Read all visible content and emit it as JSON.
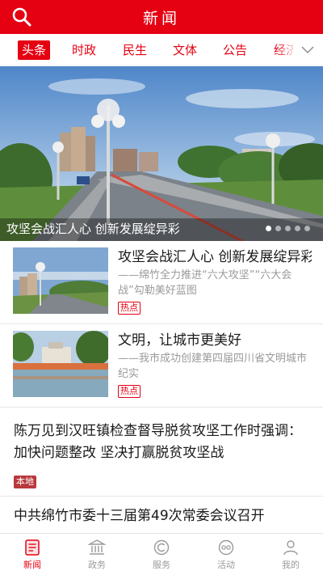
{
  "header": {
    "title": "新闻",
    "search_icon": "search-icon"
  },
  "tabs": [
    {
      "label": "头条",
      "active": true
    },
    {
      "label": "时政",
      "active": false
    },
    {
      "label": "民生",
      "active": false
    },
    {
      "label": "文体",
      "active": false
    },
    {
      "label": "公告",
      "active": false
    },
    {
      "label": "经济",
      "active": false
    }
  ],
  "banner": {
    "caption": "攻坚会战汇人心  创新发展绽异彩",
    "slide_count": 5,
    "current_slide": 1
  },
  "news": [
    {
      "title": "攻坚会战汇人心  创新发展绽异彩",
      "subtitle": "——绵竹全力推进“六大攻坚”“六大会战”勾勒美好蓝图",
      "tag": "热点"
    },
    {
      "title": "文明，让城市更美好",
      "subtitle": "——我市成功创建第四届四川省文明城市纪实",
      "tag": "热点"
    },
    {
      "title": "陈万见到汉旺镇检查督导脱贫攻坚工作时强调：加快问题整改  坚决打赢脱贫攻坚战",
      "tag": "本地"
    },
    {
      "title": "中共绵竹市委十三届第49次常委会议召开"
    }
  ],
  "bottom_nav": [
    {
      "label": "新闻",
      "icon": "news-icon",
      "active": true
    },
    {
      "label": "政务",
      "icon": "government-icon",
      "active": false
    },
    {
      "label": "服务",
      "icon": "service-icon",
      "active": false
    },
    {
      "label": "活动",
      "icon": "activity-icon",
      "active": false
    },
    {
      "label": "我的",
      "icon": "profile-icon",
      "active": false
    }
  ],
  "colors": {
    "brand_red": "#e50012",
    "tag_solid": "#b8393d"
  }
}
